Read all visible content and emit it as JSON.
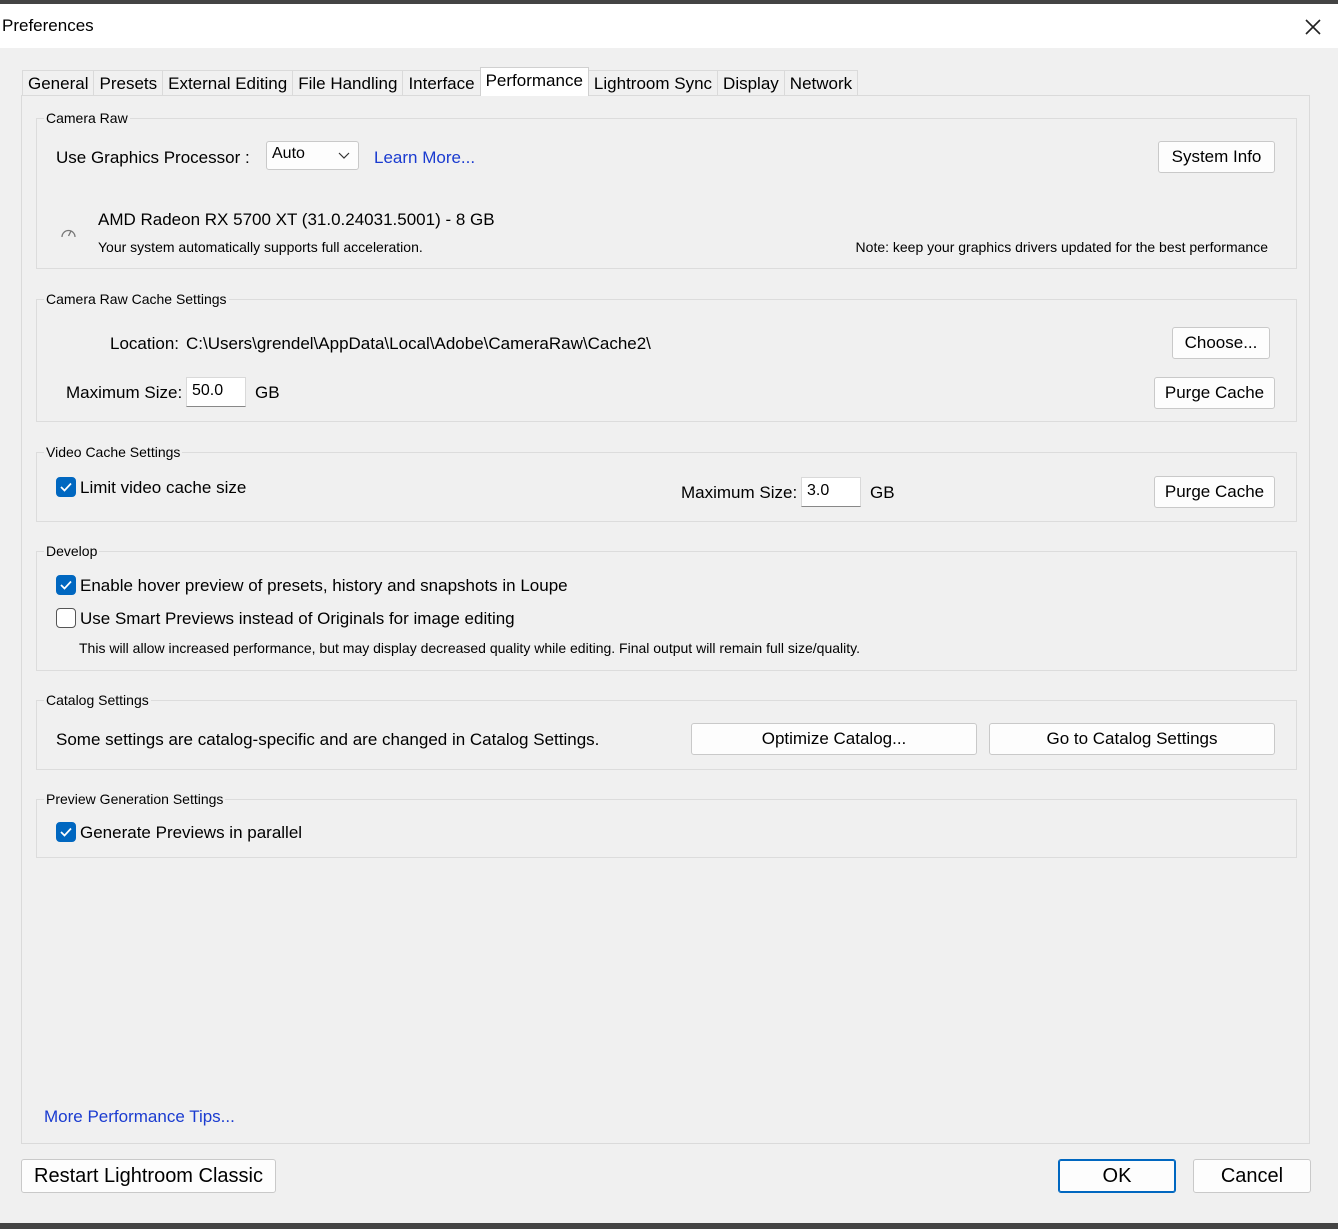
{
  "window": {
    "title": "Preferences"
  },
  "tabs": [
    {
      "label": "General"
    },
    {
      "label": "Presets"
    },
    {
      "label": "External Editing"
    },
    {
      "label": "File Handling"
    },
    {
      "label": "Interface"
    },
    {
      "label": "Performance"
    },
    {
      "label": "Lightroom Sync"
    },
    {
      "label": "Display"
    },
    {
      "label": "Network"
    }
  ],
  "active_tab": "Performance",
  "camera_raw": {
    "group_label": "Camera Raw",
    "gpu_label": "Use Graphics Processor :",
    "gpu_value": "Auto",
    "learn_more": "Learn More...",
    "system_info": "System Info",
    "gpu_name": "AMD Radeon RX 5700 XT (31.0.24031.5001) - 8 GB",
    "gpu_status": "Your system automatically supports full acceleration.",
    "note": "Note: keep your graphics drivers updated for the best performance"
  },
  "camera_raw_cache": {
    "group_label": "Camera Raw Cache Settings",
    "location_label": "Location:",
    "location_value": "C:\\Users\\grendel\\AppData\\Local\\Adobe\\CameraRaw\\Cache2\\",
    "choose": "Choose...",
    "max_size_label": "Maximum Size:",
    "max_size_value": "50.0",
    "unit": "GB",
    "purge": "Purge Cache"
  },
  "video_cache": {
    "group_label": "Video Cache Settings",
    "limit_label": "Limit video cache size",
    "limit_checked": true,
    "max_size_label": "Maximum Size:",
    "max_size_value": "3.0",
    "unit": "GB",
    "purge": "Purge Cache"
  },
  "develop": {
    "group_label": "Develop",
    "hover_label": "Enable hover preview of presets, history and snapshots in Loupe",
    "hover_checked": true,
    "smart_label": "Use Smart Previews instead of Originals for image editing",
    "smart_checked": false,
    "smart_note": "This will allow increased performance, but may display decreased quality while editing. Final output will remain full size/quality."
  },
  "catalog": {
    "group_label": "Catalog Settings",
    "text": "Some settings are catalog-specific and are changed in Catalog Settings.",
    "optimize": "Optimize Catalog...",
    "goto": "Go to Catalog Settings"
  },
  "preview_gen": {
    "group_label": "Preview Generation Settings",
    "parallel_label": "Generate Previews in parallel",
    "parallel_checked": true
  },
  "more_tips": "More Performance Tips...",
  "footer": {
    "restart": "Restart Lightroom Classic",
    "ok": "OK",
    "cancel": "Cancel"
  },
  "colors": {
    "accent": "#0067c0",
    "link": "#1a3bd0"
  }
}
